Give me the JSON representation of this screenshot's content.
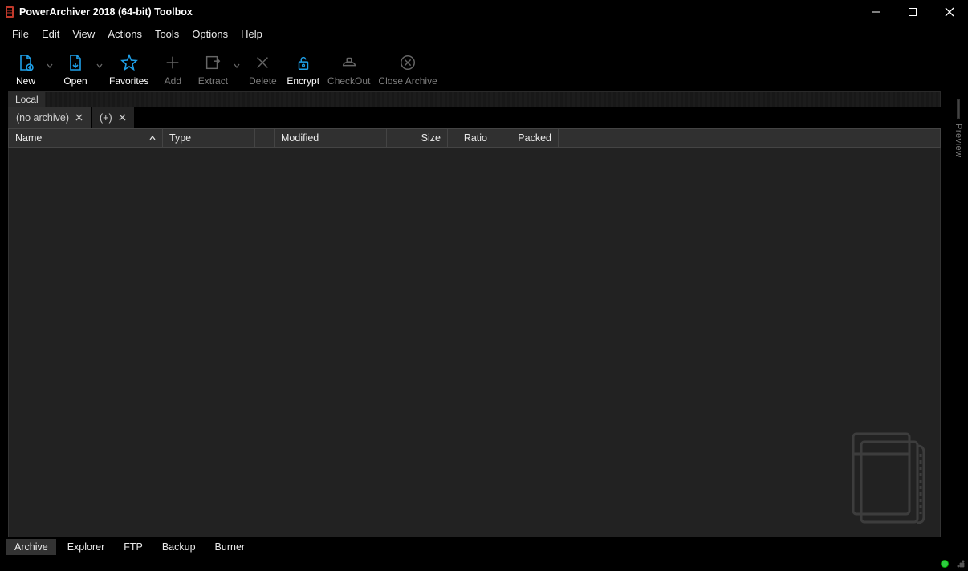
{
  "window": {
    "title": "PowerArchiver 2018 (64-bit) Toolbox"
  },
  "menu": {
    "items": [
      "File",
      "Edit",
      "View",
      "Actions",
      "Tools",
      "Options",
      "Help"
    ]
  },
  "toolbar": {
    "new": {
      "label": "New",
      "enabled": true
    },
    "open": {
      "label": "Open",
      "enabled": true
    },
    "favorites": {
      "label": "Favorites",
      "enabled": true
    },
    "add": {
      "label": "Add",
      "enabled": false
    },
    "extract": {
      "label": "Extract",
      "enabled": false
    },
    "delete": {
      "label": "Delete",
      "enabled": false
    },
    "encrypt": {
      "label": "Encrypt",
      "enabled": true
    },
    "checkout": {
      "label": "CheckOut",
      "enabled": false
    },
    "closearchive": {
      "label": "Close Archive",
      "enabled": false
    }
  },
  "breadcrumb": {
    "local": "Local"
  },
  "tabs": {
    "items": [
      {
        "label": "(no archive)"
      },
      {
        "label": "(+)"
      }
    ]
  },
  "columns": {
    "name": "Name",
    "type": "Type",
    "modified": "Modified",
    "size": "Size",
    "ratio": "Ratio",
    "packed": "Packed"
  },
  "preview": {
    "label": "Preview"
  },
  "modes": {
    "items": [
      "Archive",
      "Explorer",
      "FTP",
      "Backup",
      "Burner"
    ],
    "active": "Archive"
  }
}
